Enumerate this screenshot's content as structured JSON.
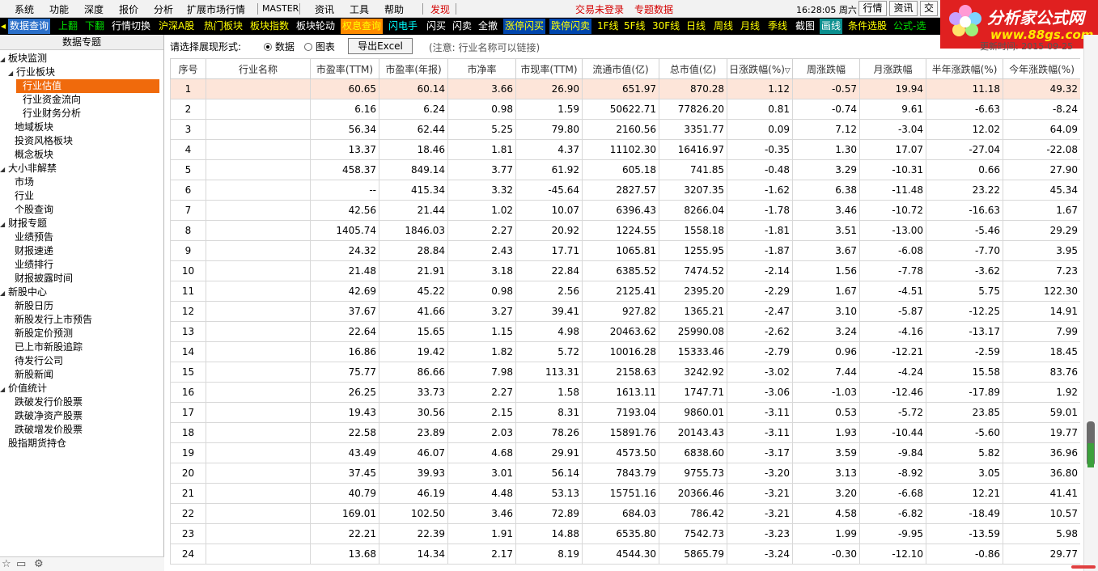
{
  "menubar": {
    "items": [
      "系统",
      "功能",
      "深度",
      "报价",
      "分析",
      "扩展市场行情",
      "MASTER",
      "资讯",
      "工具",
      "帮助",
      "发现"
    ],
    "status_left": "交易未登录",
    "status_right": "专题数据",
    "time": "16:28:05 周六",
    "buttons": [
      "行情",
      "资讯",
      "交"
    ]
  },
  "toolbar": {
    "items": [
      "数据查询",
      "上翻",
      "下翻",
      "行情切换",
      "沪深A股",
      "热门板块",
      "板块指数",
      "板块轮动",
      "权息查询",
      "闪电手",
      "闪买",
      "闪卖",
      "全撤",
      "涨停闪买",
      "跌停闪卖",
      "1F线",
      "5F线",
      "30F线",
      "日线",
      "周线",
      "月线",
      "季线",
      "截图",
      "画线",
      "条件选股",
      "公式-选"
    ]
  },
  "logo": {
    "title": "分析家公式网",
    "url": "www.88gs.com"
  },
  "sidebar": {
    "title": "数据专题",
    "tree": [
      {
        "label": "板块监测",
        "level": 0,
        "expanded": true
      },
      {
        "label": "行业板块",
        "level": 1,
        "expanded": true
      },
      {
        "label": "行业估值",
        "level": 2,
        "selected": true
      },
      {
        "label": "行业资金流向",
        "level": 2
      },
      {
        "label": "行业财务分析",
        "level": 2
      },
      {
        "label": "地域板块",
        "level": 1
      },
      {
        "label": "投资风格板块",
        "level": 1
      },
      {
        "label": "概念板块",
        "level": 1
      },
      {
        "label": "大小非解禁",
        "level": 0,
        "expanded": true
      },
      {
        "label": "市场",
        "level": 1
      },
      {
        "label": "行业",
        "level": 1
      },
      {
        "label": "个股查询",
        "level": 1
      },
      {
        "label": "财报专题",
        "level": 0,
        "expanded": true
      },
      {
        "label": "业绩预告",
        "level": 1
      },
      {
        "label": "财报速递",
        "level": 1
      },
      {
        "label": "业绩排行",
        "level": 1
      },
      {
        "label": "财报披露时间",
        "level": 1
      },
      {
        "label": "新股中心",
        "level": 0,
        "expanded": true
      },
      {
        "label": "新股日历",
        "level": 1
      },
      {
        "label": "新股发行上市预告",
        "level": 1
      },
      {
        "label": "新股定价预测",
        "level": 1
      },
      {
        "label": "已上市新股追踪",
        "level": 1
      },
      {
        "label": "待发行公司",
        "level": 1
      },
      {
        "label": "新股新闻",
        "level": 1
      },
      {
        "label": "价值统计",
        "level": 0,
        "expanded": true
      },
      {
        "label": "跌破发行价股票",
        "level": 1
      },
      {
        "label": "跌破净资产股票",
        "level": 1
      },
      {
        "label": "跌破增发价股票",
        "level": 1
      },
      {
        "label": "股指期货持仓",
        "level": 0
      }
    ]
  },
  "options": {
    "label": "请选择展现形式:",
    "radio_data": "数据",
    "radio_chart": "图表",
    "export_label": "导出Excel",
    "note": "(注意: 行业名称可以链接)",
    "update_time": "更新时间: 2015-09-25"
  },
  "table": {
    "headers": [
      "序号",
      "行业名称",
      "市盈率(TTM)",
      "市盈率(年报)",
      "市净率",
      "市现率(TTM)",
      "流通市值(亿)",
      "总市值(亿)",
      "日涨跌幅(%)",
      "周涨跌幅",
      "月涨跌幅",
      "半年涨跌幅(%)",
      "今年涨跌幅(%)"
    ],
    "rows": [
      [
        "1",
        "",
        "60.65",
        "60.14",
        "3.66",
        "26.90",
        "651.97",
        "870.28",
        "1.12",
        "-0.57",
        "19.94",
        "11.18",
        "49.32"
      ],
      [
        "2",
        "",
        "6.16",
        "6.24",
        "0.98",
        "1.59",
        "50622.71",
        "77826.20",
        "0.81",
        "-0.74",
        "9.61",
        "-6.63",
        "-8.24"
      ],
      [
        "3",
        "",
        "56.34",
        "62.44",
        "5.25",
        "79.80",
        "2160.56",
        "3351.77",
        "0.09",
        "7.12",
        "-3.04",
        "12.02",
        "64.09"
      ],
      [
        "4",
        "",
        "13.37",
        "18.46",
        "1.81",
        "4.37",
        "11102.30",
        "16416.97",
        "-0.35",
        "1.30",
        "17.07",
        "-27.04",
        "-22.08"
      ],
      [
        "5",
        "",
        "458.37",
        "849.14",
        "3.77",
        "61.92",
        "605.18",
        "741.85",
        "-0.48",
        "3.29",
        "-10.31",
        "0.66",
        "27.90"
      ],
      [
        "6",
        "",
        "--",
        "415.34",
        "3.32",
        "-45.64",
        "2827.57",
        "3207.35",
        "-1.62",
        "6.38",
        "-11.48",
        "23.22",
        "45.34"
      ],
      [
        "7",
        "",
        "42.56",
        "21.44",
        "1.02",
        "10.07",
        "6396.43",
        "8266.04",
        "-1.78",
        "3.46",
        "-10.72",
        "-16.63",
        "1.67"
      ],
      [
        "8",
        "",
        "1405.74",
        "1846.03",
        "2.27",
        "20.92",
        "1224.55",
        "1558.18",
        "-1.81",
        "3.51",
        "-13.00",
        "-5.46",
        "29.29"
      ],
      [
        "9",
        "",
        "24.32",
        "28.84",
        "2.43",
        "17.71",
        "1065.81",
        "1255.95",
        "-1.87",
        "3.67",
        "-6.08",
        "-7.70",
        "3.95"
      ],
      [
        "10",
        "",
        "21.48",
        "21.91",
        "3.18",
        "22.84",
        "6385.52",
        "7474.52",
        "-2.14",
        "1.56",
        "-7.78",
        "-3.62",
        "7.23"
      ],
      [
        "11",
        "",
        "42.69",
        "45.22",
        "0.98",
        "2.56",
        "2125.41",
        "2395.20",
        "-2.29",
        "1.67",
        "-4.51",
        "5.75",
        "122.30"
      ],
      [
        "12",
        "",
        "37.67",
        "41.66",
        "3.27",
        "39.41",
        "927.82",
        "1365.21",
        "-2.47",
        "3.10",
        "-5.87",
        "-12.25",
        "14.91"
      ],
      [
        "13",
        "",
        "22.64",
        "15.65",
        "1.15",
        "4.98",
        "20463.62",
        "25990.08",
        "-2.62",
        "3.24",
        "-4.16",
        "-13.17",
        "7.99"
      ],
      [
        "14",
        "",
        "16.86",
        "19.42",
        "1.82",
        "5.72",
        "10016.28",
        "15333.46",
        "-2.79",
        "0.96",
        "-12.21",
        "-2.59",
        "18.45"
      ],
      [
        "15",
        "",
        "75.77",
        "86.66",
        "7.98",
        "113.31",
        "2158.63",
        "3242.92",
        "-3.02",
        "7.44",
        "-4.24",
        "15.58",
        "83.76"
      ],
      [
        "16",
        "",
        "26.25",
        "33.73",
        "2.27",
        "1.58",
        "1613.11",
        "1747.71",
        "-3.06",
        "-1.03",
        "-12.46",
        "-17.89",
        "1.92"
      ],
      [
        "17",
        "",
        "19.43",
        "30.56",
        "2.15",
        "8.31",
        "7193.04",
        "9860.01",
        "-3.11",
        "0.53",
        "-5.72",
        "23.85",
        "59.01"
      ],
      [
        "18",
        "",
        "22.58",
        "23.89",
        "2.03",
        "78.26",
        "15891.76",
        "20143.43",
        "-3.11",
        "1.93",
        "-10.44",
        "-5.60",
        "19.77"
      ],
      [
        "19",
        "",
        "43.49",
        "46.07",
        "4.68",
        "29.91",
        "4573.50",
        "6838.60",
        "-3.17",
        "3.59",
        "-9.84",
        "5.82",
        "36.96"
      ],
      [
        "20",
        "",
        "37.45",
        "39.93",
        "3.01",
        "56.14",
        "7843.79",
        "9755.73",
        "-3.20",
        "3.13",
        "-8.92",
        "3.05",
        "36.80"
      ],
      [
        "21",
        "",
        "40.79",
        "46.19",
        "4.48",
        "53.13",
        "15751.16",
        "20366.46",
        "-3.21",
        "3.20",
        "-6.68",
        "12.21",
        "41.41"
      ],
      [
        "22",
        "",
        "169.01",
        "102.50",
        "3.46",
        "72.89",
        "684.03",
        "786.42",
        "-3.21",
        "4.58",
        "-6.82",
        "-18.49",
        "10.57"
      ],
      [
        "23",
        "",
        "22.21",
        "22.39",
        "1.91",
        "14.88",
        "6535.80",
        "7542.73",
        "-3.23",
        "1.99",
        "-9.95",
        "-13.59",
        "5.98"
      ],
      [
        "24",
        "",
        "13.68",
        "14.34",
        "2.17",
        "8.19",
        "4544.30",
        "5865.79",
        "-3.24",
        "-0.30",
        "-12.10",
        "-0.86",
        "29.77"
      ]
    ]
  },
  "colors": {
    "selected_row": "#fde5d9",
    "tree_selected": "#f06a0c",
    "toolbar_bg": "#000000",
    "logo_bg": "#e02020"
  }
}
